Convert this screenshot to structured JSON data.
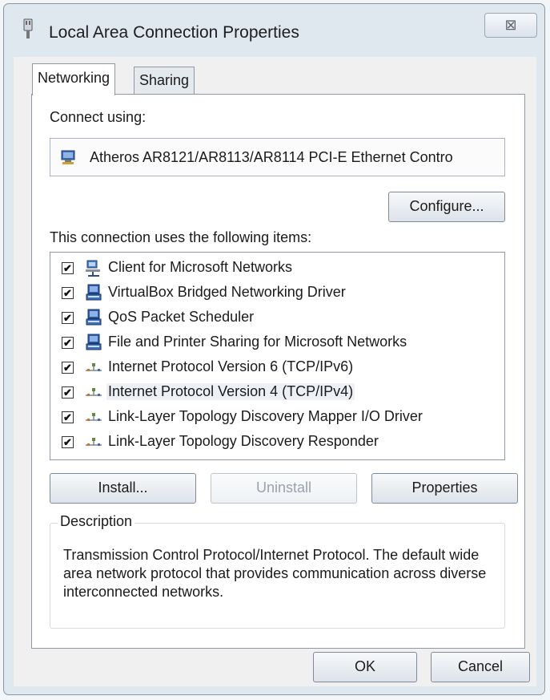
{
  "window": {
    "title": "Local Area Connection Properties",
    "close_glyph": "⊠"
  },
  "tabs": [
    {
      "label": "Networking",
      "active": true
    },
    {
      "label": "Sharing",
      "active": false
    }
  ],
  "connect_using": {
    "label": "Connect using:",
    "adapter": "Atheros AR8121/AR8113/AR8114 PCI-E Ethernet Contro",
    "configure_button": "Configure..."
  },
  "items": {
    "label": "This connection uses the following items:",
    "list": [
      {
        "label": "Client for Microsoft Networks",
        "checked": true,
        "icon": "network-client-icon"
      },
      {
        "label": "VirtualBox Bridged Networking Driver",
        "checked": true,
        "icon": "network-service-icon"
      },
      {
        "label": "QoS Packet Scheduler",
        "checked": true,
        "icon": "network-service-icon"
      },
      {
        "label": "File and Printer Sharing for Microsoft Networks",
        "checked": true,
        "icon": "network-service-icon"
      },
      {
        "label": "Internet Protocol Version 6 (TCP/IPv6)",
        "checked": true,
        "icon": "protocol-icon"
      },
      {
        "label": "Internet Protocol Version 4 (TCP/IPv4)",
        "checked": true,
        "icon": "protocol-icon",
        "selected": true
      },
      {
        "label": "Link-Layer Topology Discovery Mapper I/O Driver",
        "checked": true,
        "icon": "protocol-icon"
      },
      {
        "label": "Link-Layer Topology Discovery Responder",
        "checked": true,
        "icon": "protocol-icon"
      }
    ],
    "check_glyph": "✔"
  },
  "buttons": {
    "install": "Install...",
    "uninstall": "Uninstall",
    "properties": "Properties",
    "ok": "OK",
    "cancel": "Cancel"
  },
  "description": {
    "legend": "Description",
    "text": "Transmission Control Protocol/Internet Protocol. The default wide area network protocol that provides communication across diverse interconnected networks."
  },
  "colors": {
    "window_frame": "#dfe7ef",
    "client": "#f0f0f0",
    "accent_blue": "#2f63b8"
  }
}
